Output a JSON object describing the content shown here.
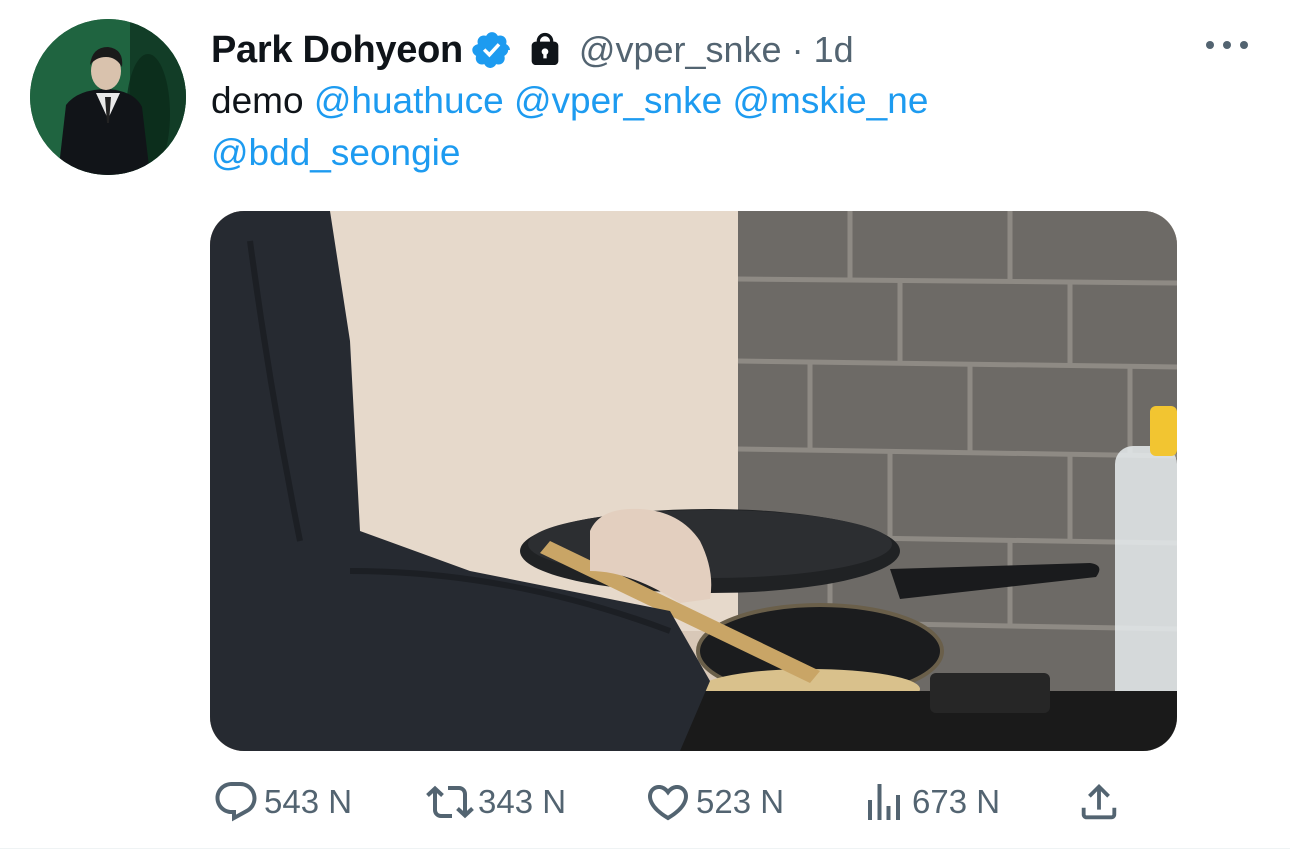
{
  "tweet": {
    "author_name": "Park Dohyeon",
    "handle": "@vper_snke",
    "separator": "·",
    "time": "1d",
    "text_prefix": "demo",
    "mentions": [
      "@huathuce",
      "@vper_snke",
      "@mskie_ne",
      "@bdd_seongie"
    ]
  },
  "icons": {
    "verified": "verified-badge-icon",
    "lock": "lock-icon",
    "more": "more-options-icon",
    "reply": "reply-icon",
    "retweet": "retweet-icon",
    "like": "like-icon",
    "views": "views-icon",
    "share": "share-icon"
  },
  "colors": {
    "accent": "#1d9bf0",
    "secondary_text": "#536471",
    "primary_text": "#0f1419"
  },
  "actions": {
    "replies": "543 N",
    "retweets": "343 N",
    "likes": "523 N",
    "views": "673 N"
  }
}
